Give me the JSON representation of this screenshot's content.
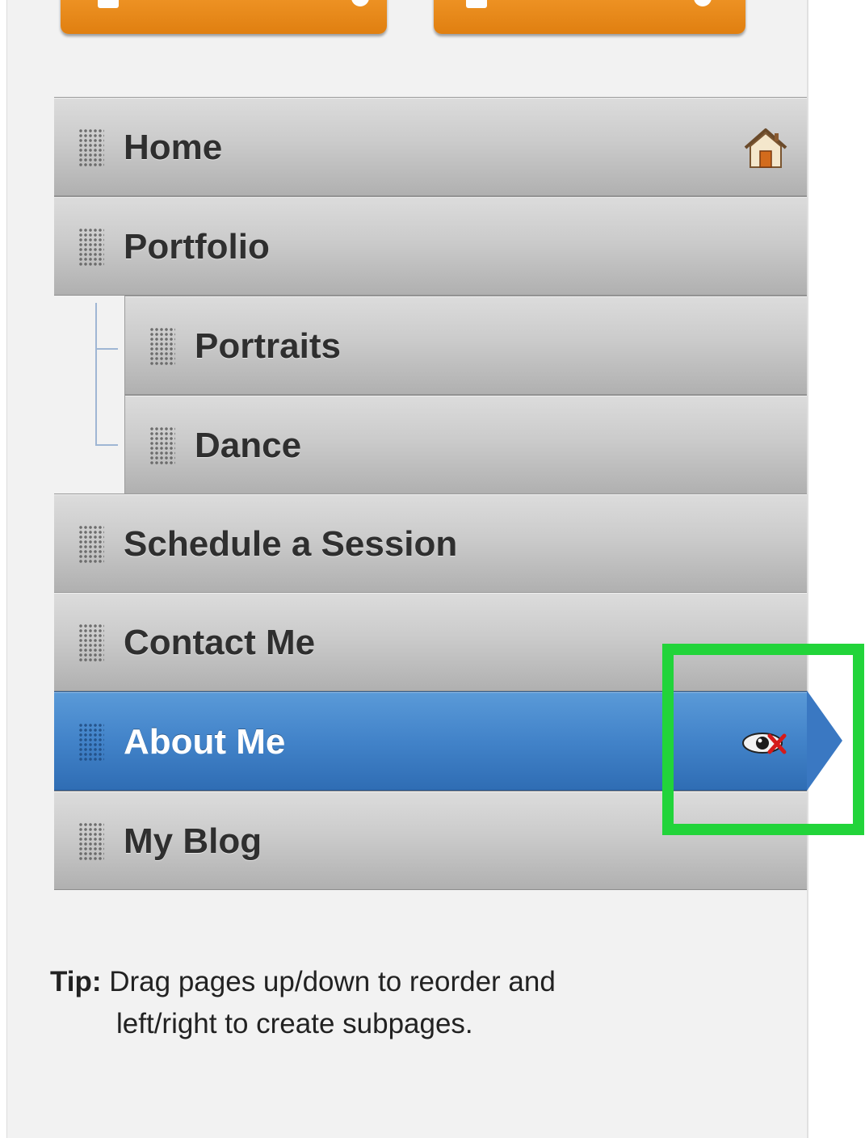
{
  "nav": {
    "items": [
      {
        "label": "Home",
        "level": 0,
        "active": false,
        "icon": "home-icon"
      },
      {
        "label": "Portfolio",
        "level": 0,
        "active": false
      },
      {
        "label": "Portraits",
        "level": 1,
        "active": false
      },
      {
        "label": "Dance",
        "level": 1,
        "active": false
      },
      {
        "label": "Schedule a Session",
        "level": 0,
        "active": false
      },
      {
        "label": "Contact Me",
        "level": 0,
        "active": false
      },
      {
        "label": "About Me",
        "level": 0,
        "active": true,
        "icon": "hidden-eye-icon"
      },
      {
        "label": "My Blog",
        "level": 0,
        "active": false
      }
    ]
  },
  "tip": {
    "label": "Tip:",
    "line1": "Drag pages up/down to reorder and",
    "line2": "left/right to create subpages."
  },
  "colors": {
    "accent": "#3a78c2",
    "toolbar_orange": "#ec8a1e",
    "highlight_green": "#22d43a"
  }
}
